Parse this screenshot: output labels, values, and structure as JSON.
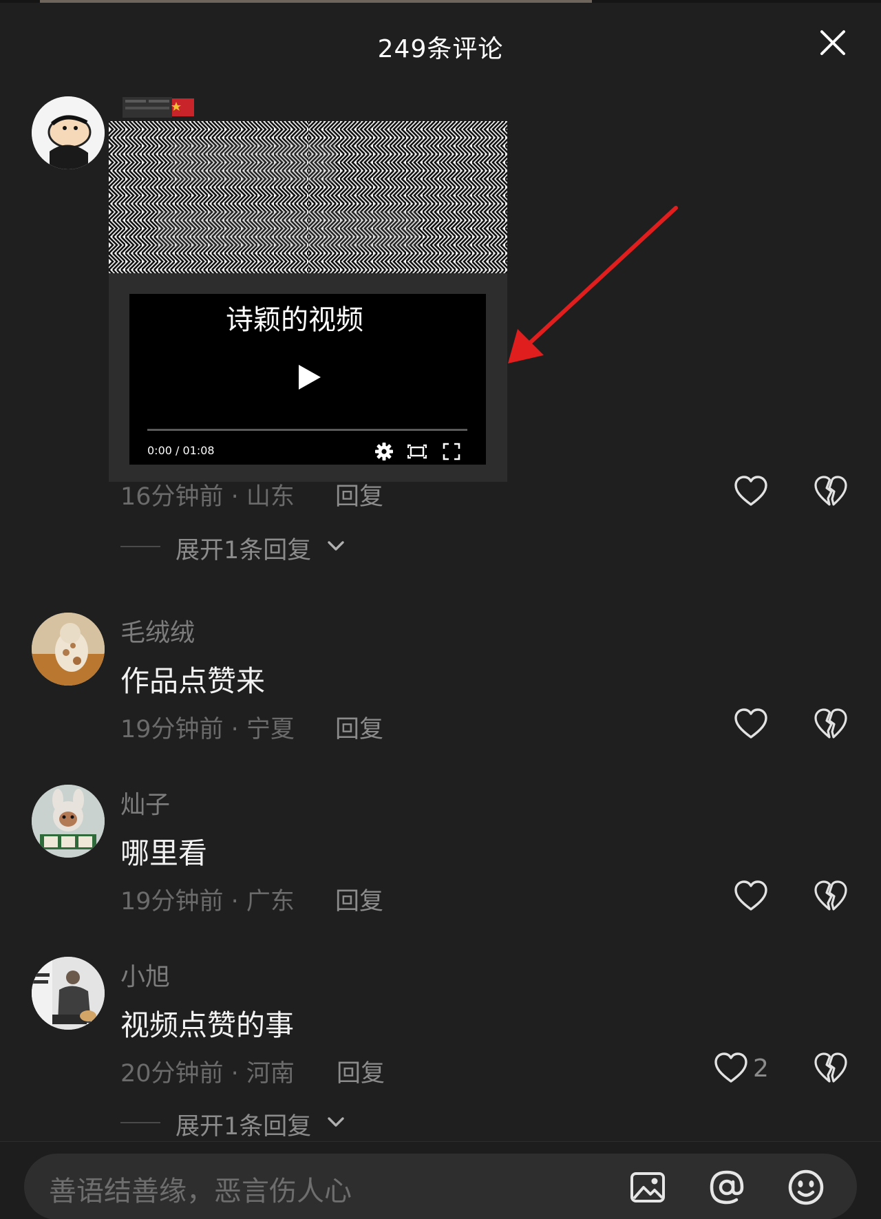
{
  "header": {
    "title": "249条评论"
  },
  "embed": {
    "video_title": "诗颖的视频",
    "time": "0:00 / 01:08",
    "progress_fraction": 0
  },
  "comments": [
    {
      "meta": "16分钟前 · 山东",
      "reply_label": "回复",
      "expand_label": "展开1条回复"
    },
    {
      "username": "毛绒绒",
      "text": "作品点赞来",
      "meta": "19分钟前 · 宁夏",
      "reply_label": "回复"
    },
    {
      "username": "灿子",
      "text": "哪里看",
      "meta": "19分钟前 · 广东",
      "reply_label": "回复"
    },
    {
      "username": "小旭",
      "text": "视频点赞的事",
      "meta": "20分钟前 · 河南",
      "reply_label": "回复",
      "like_count": "2",
      "expand_label": "展开1条回复"
    }
  ],
  "input": {
    "placeholder": "善语结善缘，恶言伤人心"
  },
  "icons": {
    "close": "close-icon",
    "like": "heart-outline-icon",
    "dislike": "broken-heart-icon",
    "image": "image-icon",
    "mention": "at-icon",
    "emoji": "emoji-icon"
  },
  "colors": {
    "background": "#1f1f1f",
    "annotation_arrow": "#e01e1e"
  }
}
